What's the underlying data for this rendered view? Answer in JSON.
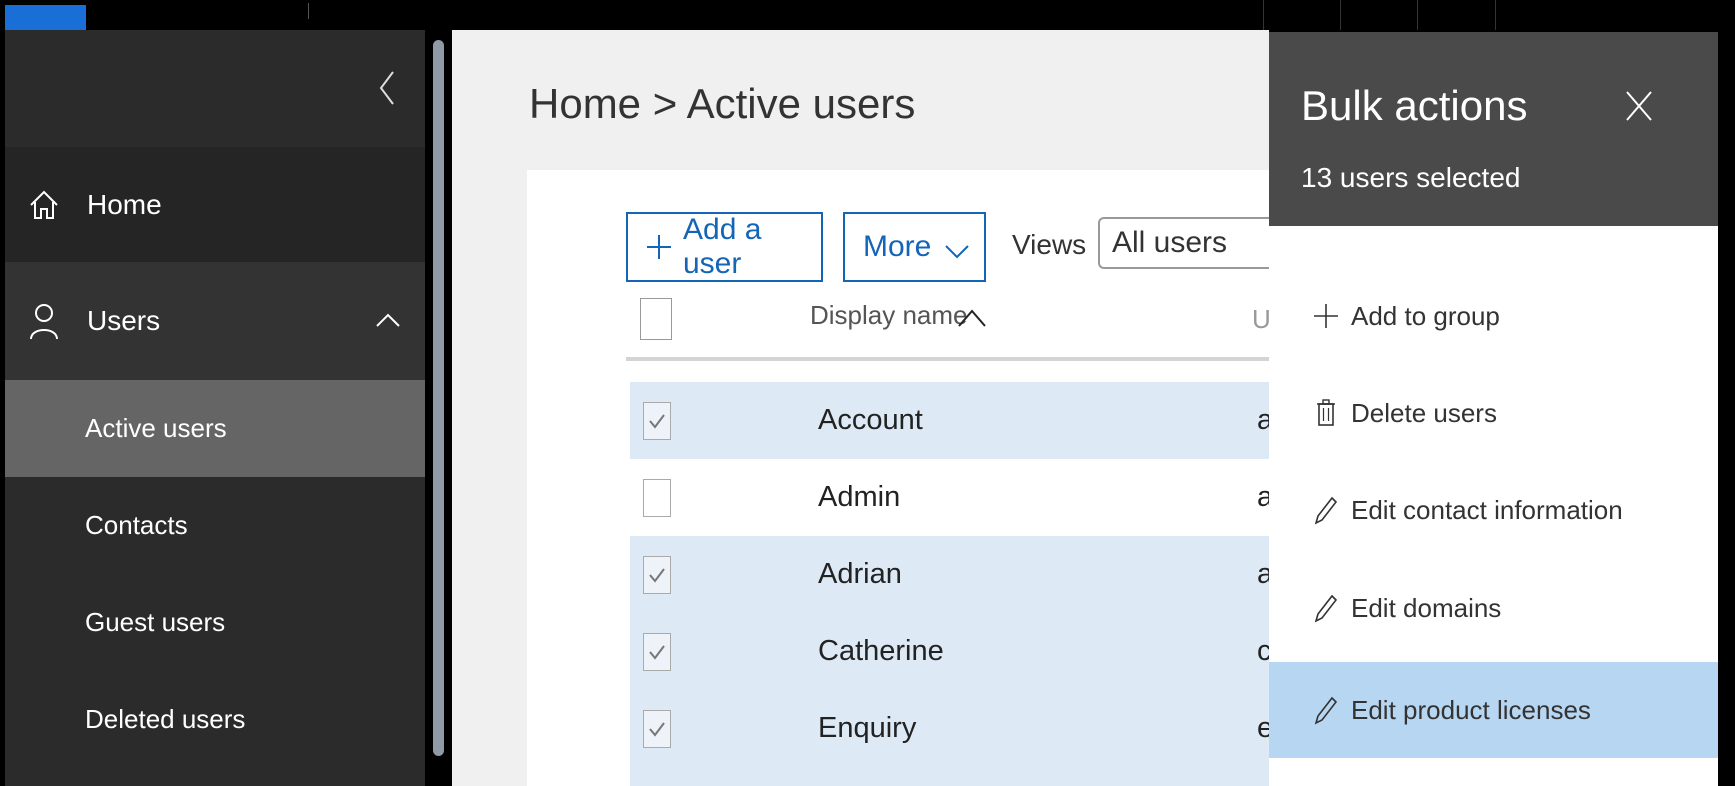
{
  "breadcrumb": "Home > Active users",
  "nav": {
    "home": "Home",
    "users": "Users",
    "sub_items": [
      "Active users",
      "Contacts",
      "Guest users",
      "Deleted users"
    ]
  },
  "toolbar": {
    "add_user": "Add a user",
    "more": "More",
    "views_label": "Views",
    "views_value": "All users"
  },
  "table": {
    "col_display_name": "Display name",
    "col_username_partial": "U",
    "rows": [
      {
        "name": "Account",
        "user": "a",
        "selected": true
      },
      {
        "name": "Admin",
        "user": "a",
        "selected": false
      },
      {
        "name": "Adrian",
        "user": "a",
        "selected": true
      },
      {
        "name": "Catherine",
        "user": "c",
        "selected": true
      },
      {
        "name": "Enquiry",
        "user": "e",
        "selected": true
      }
    ]
  },
  "bulk": {
    "title": "Bulk actions",
    "subtitle": "13 users selected",
    "actions": [
      {
        "label": "Add to group",
        "icon": "plus-icon"
      },
      {
        "label": "Delete users",
        "icon": "trash-icon"
      },
      {
        "label": "Edit contact information",
        "icon": "pencil-icon"
      },
      {
        "label": "Edit domains",
        "icon": "pencil-icon"
      },
      {
        "label": "Edit product licenses",
        "icon": "pencil-icon"
      }
    ]
  },
  "colors": {
    "accent": "#1464b8",
    "selected_row": "#dde9f5",
    "highlight": "#b7d6f2",
    "sidebar": "#2b2b2b",
    "flyout_header": "#4a4a4a"
  }
}
